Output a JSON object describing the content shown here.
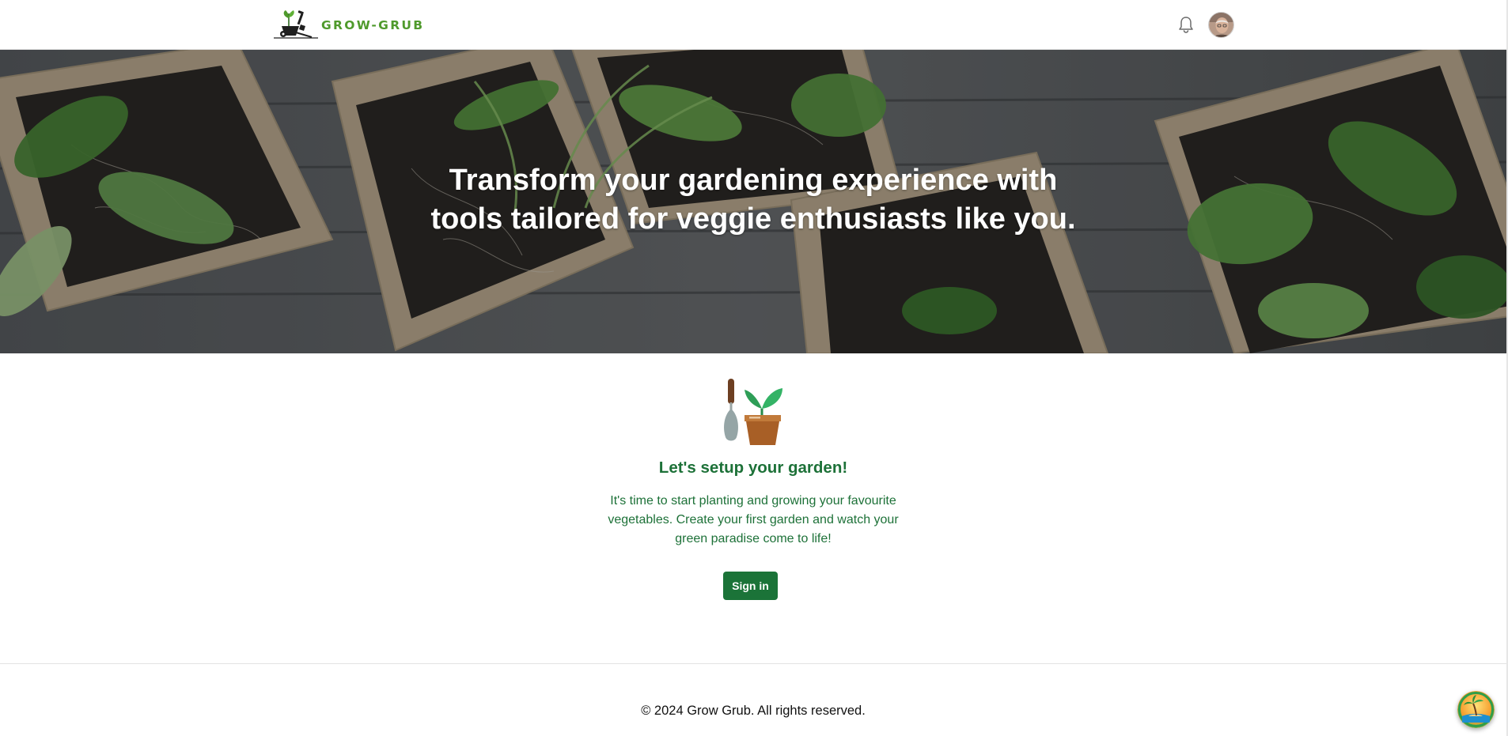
{
  "header": {
    "logo_text": "GROW-GRUB",
    "logo_icon": "wheelbarrow-plant-logo",
    "notification_icon": "bell-icon",
    "avatar_icon": "user-avatar"
  },
  "hero": {
    "title_line1": "Transform your gardening experience with",
    "title_line2": "tools tailored for veggie enthusiasts like you."
  },
  "main": {
    "icon": "trowel-and-potted-plant-icon",
    "title": "Let's setup your garden!",
    "description": "It's time to start planting and growing your favourite vegetables. Create your first garden and watch your green paradise come to life!",
    "signin_label": "Sign in"
  },
  "footer": {
    "copyright": "© 2024 Grow Grub. All rights reserved."
  },
  "colors": {
    "brand_green": "#4f9a2c",
    "text_green": "#1d7138",
    "button_green": "#1b7338"
  }
}
